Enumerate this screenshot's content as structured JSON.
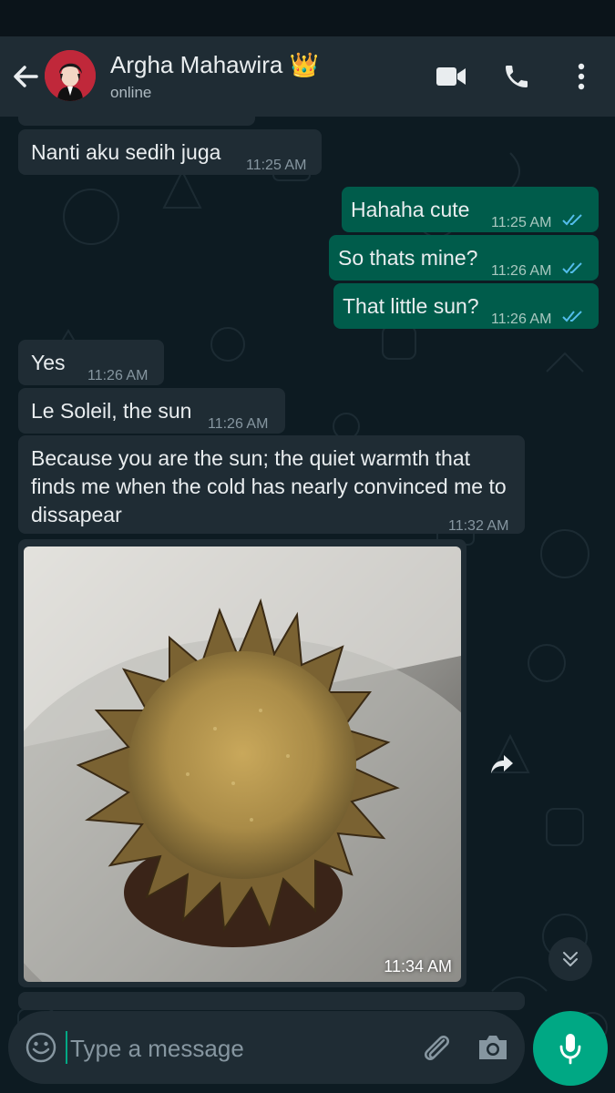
{
  "header": {
    "contact_name": "Argha Mahawira 👑",
    "status": "online"
  },
  "icons": {
    "back": "arrow-left-icon",
    "video": "video-camera-icon",
    "call": "phone-icon",
    "menu": "more-vert-icon",
    "forward": "forward-icon",
    "scroll_down": "double-chevron-down-icon",
    "emoji": "emoji-icon",
    "attach": "paperclip-icon",
    "camera": "camera-icon",
    "mic": "microphone-icon"
  },
  "messages": [
    {
      "direction": "in",
      "text": "Nanti aku sedih juga",
      "time": "11:25 AM"
    },
    {
      "direction": "out",
      "text": "Hahaha cute",
      "time": "11:25 AM",
      "status": "read"
    },
    {
      "direction": "out",
      "text": "So thats mine?",
      "time": "11:26 AM",
      "status": "read"
    },
    {
      "direction": "out",
      "text": "That little sun?",
      "time": "11:26 AM",
      "status": "read"
    },
    {
      "direction": "in",
      "text": "Yes",
      "time": "11:26 AM"
    },
    {
      "direction": "in",
      "text": "Le Soleil, the sun",
      "time": "11:26 AM"
    },
    {
      "direction": "in",
      "text": "Because you are the sun; the quiet warmth that finds me when the cold has nearly convinced me to dissapear",
      "time": "11:32 AM"
    },
    {
      "direction": "in",
      "type": "image",
      "time": "11:34 AM"
    }
  ],
  "composer": {
    "placeholder": "Type a message"
  },
  "colors": {
    "header_bg": "#1f2c34",
    "incoming_bubble": "#1f2c34",
    "outgoing_bubble": "#005c4b",
    "accent": "#00a884",
    "read_tick": "#53bdeb"
  }
}
